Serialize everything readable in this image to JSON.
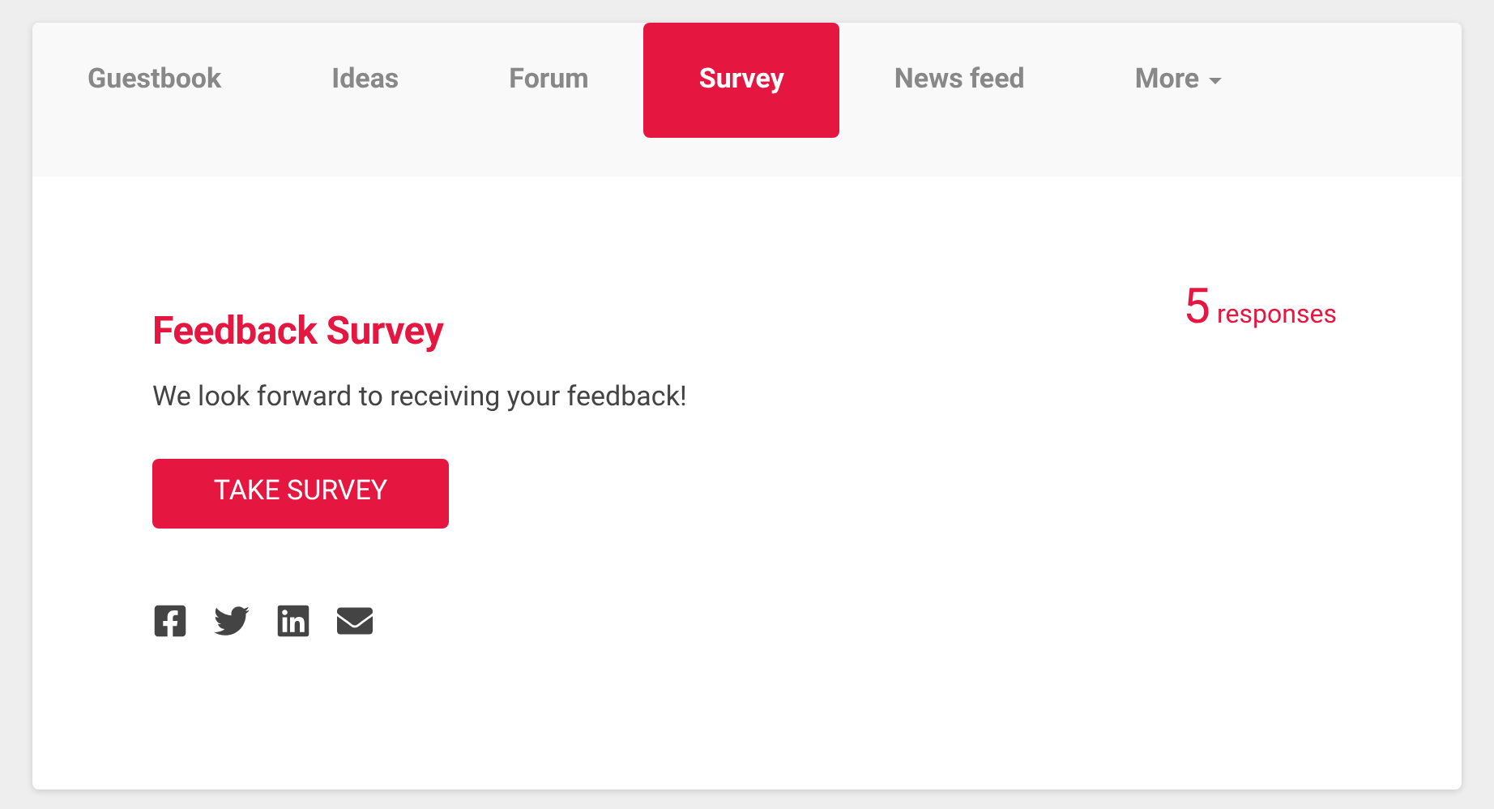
{
  "tabs": [
    {
      "label": "Guestbook",
      "selected": false,
      "kind": "link"
    },
    {
      "label": "Ideas",
      "selected": false,
      "kind": "link"
    },
    {
      "label": "Forum",
      "selected": false,
      "kind": "link"
    },
    {
      "label": "Survey",
      "selected": true,
      "kind": "link"
    },
    {
      "label": "News feed",
      "selected": false,
      "kind": "link"
    },
    {
      "label": "More",
      "selected": false,
      "kind": "dropdown"
    }
  ],
  "survey": {
    "title": "Feedback Survey",
    "description": "We look forward to receiving your feedback!",
    "button": "TAKE SURVEY",
    "response_count": "5",
    "response_label": "responses"
  },
  "share_icons": [
    {
      "kind": "facebook"
    },
    {
      "kind": "twitter"
    },
    {
      "kind": "linkedin"
    },
    {
      "kind": "email"
    }
  ]
}
